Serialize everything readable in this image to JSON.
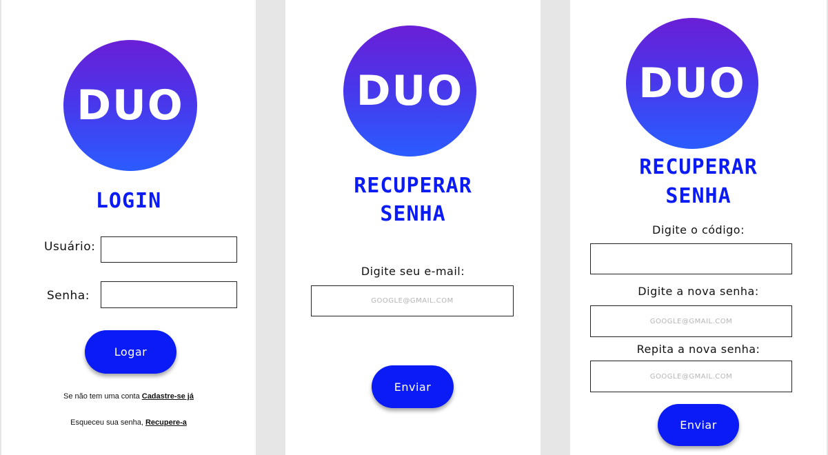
{
  "brand": {
    "logo_text": "DUO"
  },
  "login": {
    "title": "LOGIN",
    "user_label": "Usuário:",
    "password_label": "Senha:",
    "submit_label": "Logar",
    "signup_prefix": "Se não tem uma conta ",
    "signup_link": "Cadastre-se já",
    "recover_prefix": "Esqueceu sua senha, ",
    "recover_link": "Recupere-a"
  },
  "recover_request": {
    "title_line1": "RECUPERAR",
    "title_line2": "SENHA",
    "email_label": "Digite seu e-mail:",
    "email_placeholder": "GOOGLE@GMAIL.COM",
    "submit_label": "Enviar"
  },
  "recover_reset": {
    "title_line1": "RECUPERAR",
    "title_line2": "SENHA",
    "code_label": "Digite o código:",
    "new_password_label": "Digite a nova senha:",
    "new_password_placeholder": "GOOGLE@GMAIL.COM",
    "repeat_password_label": "Repita a nova senha:",
    "repeat_password_placeholder": "GOOGLE@GMAIL.COM",
    "submit_label": "Enviar"
  },
  "colors": {
    "accent": "#0a1bf5",
    "background": "#e6e6e6",
    "panel": "#ffffff"
  }
}
